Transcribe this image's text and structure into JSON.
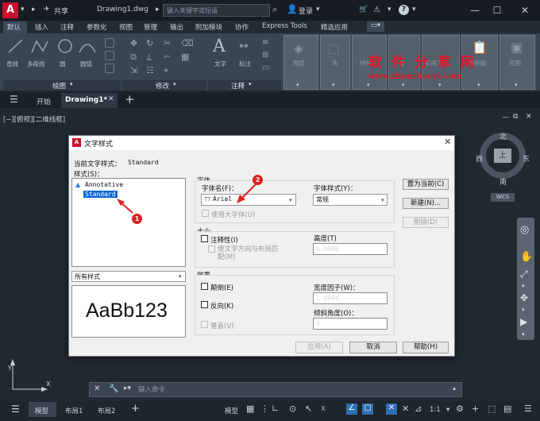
{
  "app": {
    "logo": "A",
    "share": "共享",
    "file_name": "Drawing1.dwg",
    "search_placeholder": "键入关键字或短语",
    "login": "登录",
    "help": "?"
  },
  "ribbon_tabs": [
    "默认",
    "插入",
    "注释",
    "参数化",
    "视图",
    "管理",
    "输出",
    "附加模块",
    "协作",
    "Express Tools",
    "精选应用"
  ],
  "ribbon": {
    "draw_tools": [
      "直线",
      "多段线",
      "圆",
      "圆弧"
    ],
    "text_tools": [
      "文字",
      "标注"
    ],
    "panels": [
      "绘图",
      "修改",
      "注释"
    ],
    "right_groups": [
      "图层",
      "块",
      "特性",
      "组",
      "实用工具",
      "剪贴板",
      "视图"
    ]
  },
  "watermark": {
    "title": "软 件 分 享 网",
    "url": "www.zhanshaoyi.com"
  },
  "file_tabs": {
    "start": "开始",
    "active": "Drawing1*",
    "add": "+"
  },
  "viewport": {
    "label": "[−][俯视][二维线框]",
    "cube_top": "上",
    "north": "北",
    "south": "南",
    "east": "东",
    "west": "西",
    "wcs": "WCS"
  },
  "dialog": {
    "title": "文字样式",
    "current_style_label": "当前文字样式：",
    "current_style_value": "Standard",
    "styles_label": "样式(S)：",
    "styles": [
      "Annotative",
      "Standard"
    ],
    "selected_style": "Standard",
    "filter_value": "所有样式",
    "preview_text": "AaBb123",
    "font_group": "字体",
    "font_name_label": "字体名(F)：",
    "font_name_value": "Arial",
    "font_style_label": "字体样式(Y)：",
    "font_style_value": "常规",
    "use_big_font": "使用大字体(U)",
    "size_group": "大小",
    "annotative": "注释性(I)",
    "match_orientation": "使文字方向与布局匹配(M)",
    "height_label": "高度(T)",
    "height_value": "0.0000",
    "effects_group": "效果",
    "upside_down": "颠倒(E)",
    "backwards": "反向(K)",
    "vertical": "垂直(V)",
    "width_factor_label": "宽度因子(W)：",
    "width_factor_value": "1.0000",
    "oblique_label": "倾斜角度(O)：",
    "oblique_value": "0",
    "set_current": "置为当前(C)",
    "new": "新建(N)...",
    "delete": "删除(D)",
    "apply": "应用(A)",
    "cancel": "取消",
    "help": "帮助(H)",
    "marker1": "1",
    "marker2": "2"
  },
  "command": {
    "placeholder": "键入命令"
  },
  "status": {
    "model_tab": "模型",
    "layout1": "布局1",
    "layout2": "布局2",
    "model_space": "模型",
    "scale": "1:1"
  },
  "colors": {
    "accent_red": "#c8102e",
    "marker_red": "#e02020",
    "selection_blue": "#0a64d8"
  }
}
